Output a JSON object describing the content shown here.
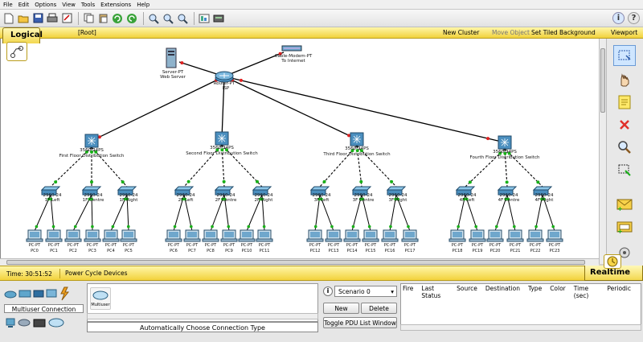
{
  "menu": [
    "File",
    "Edit",
    "Options",
    "View",
    "Tools",
    "Extensions",
    "Help"
  ],
  "logical_bar": {
    "tab": "Logical",
    "root": "[Root]",
    "new_cluster": "New Cluster",
    "move_object": "Move Object",
    "set_tiled_background": "Set Tiled Background",
    "viewport": "Viewport"
  },
  "network": {
    "router": {
      "label1": "Router-PT",
      "label2": "ISP"
    },
    "server": {
      "label1": "Server-PT",
      "label2": "Web Server"
    },
    "modem": {
      "label1": "Cable-Modem-PT",
      "label2": "To Internet"
    },
    "distribution_switches": [
      {
        "model": "3560-24PS",
        "name": "First Floor Distribution Switch"
      },
      {
        "model": "3560-24PS",
        "name": "Second Floor Distribution Switch"
      },
      {
        "model": "3560-24PS",
        "name": "Third Floor Distribution Switch"
      },
      {
        "model": "3560-24PS",
        "name": "Fourth Floor Distribution Switch"
      }
    ],
    "access_switches": [
      {
        "model": "2960-24",
        "name": "1F Left"
      },
      {
        "model": "2960-24",
        "name": "1F Centre"
      },
      {
        "model": "2960-24",
        "name": "1F Right"
      },
      {
        "model": "2960-24",
        "name": "2F Left"
      },
      {
        "model": "2960-24",
        "name": "2F Centre"
      },
      {
        "model": "2960-24",
        "name": "2F Right"
      },
      {
        "model": "2960-24",
        "name": "3F Left"
      },
      {
        "model": "2960-24",
        "name": "3F Centre"
      },
      {
        "model": "2960-24",
        "name": "3F Right"
      },
      {
        "model": "2960-24",
        "name": "4F Left"
      },
      {
        "model": "2960-24",
        "name": "4F Centre"
      },
      {
        "model": "2960-24",
        "name": "4F Right"
      }
    ],
    "pcs": [
      {
        "model": "PC-PT",
        "name": "PC0"
      },
      {
        "model": "PC-PT",
        "name": "PC1"
      },
      {
        "model": "PC-PT",
        "name": "PC2"
      },
      {
        "model": "PC-PT",
        "name": "PC3"
      },
      {
        "model": "PC-PT",
        "name": "PC4"
      },
      {
        "model": "PC-PT",
        "name": "PC5"
      },
      {
        "model": "PC-PT",
        "name": "PC6"
      },
      {
        "model": "PC-PT",
        "name": "PC7"
      },
      {
        "model": "PC-PT",
        "name": "PC8"
      },
      {
        "model": "PC-PT",
        "name": "PC9"
      },
      {
        "model": "PC-PT",
        "name": "PC10"
      },
      {
        "model": "PC-PT",
        "name": "PC11"
      },
      {
        "model": "PC-PT",
        "name": "PC12"
      },
      {
        "model": "PC-PT",
        "name": "PC13"
      },
      {
        "model": "PC-PT",
        "name": "PC14"
      },
      {
        "model": "PC-PT",
        "name": "PC15"
      },
      {
        "model": "PC-PT",
        "name": "PC16"
      },
      {
        "model": "PC-PT",
        "name": "PC17"
      },
      {
        "model": "PC-PT",
        "name": "PC18"
      },
      {
        "model": "PC-PT",
        "name": "PC19"
      },
      {
        "model": "PC-PT",
        "name": "PC20"
      },
      {
        "model": "PC-PT",
        "name": "PC21"
      },
      {
        "model": "PC-PT",
        "name": "PC22"
      },
      {
        "model": "PC-PT",
        "name": "PC23"
      }
    ]
  },
  "status": {
    "time": "Time: 30:51:52",
    "power_cycle": "Power Cycle Devices",
    "realtime": "Realtime"
  },
  "bottom": {
    "multiuser_connection": "Multiuser Connection",
    "multiuser_item": "Multiuser",
    "auto_connection": "Automatically Choose Connection Type",
    "scenario": "Scenario 0",
    "new_button": "New",
    "delete_button": "Delete",
    "toggle_pdu": "Toggle PDU List Window",
    "pdu_columns": [
      "Fire",
      "Last Status",
      "Source",
      "Destination",
      "Type",
      "Color",
      "Time (sec)",
      "Periodic"
    ]
  },
  "colors": {
    "yellow_bar": "#f2d23c",
    "link_black": "#000000",
    "link_down": "#e02020",
    "link_up": "#19b019"
  }
}
